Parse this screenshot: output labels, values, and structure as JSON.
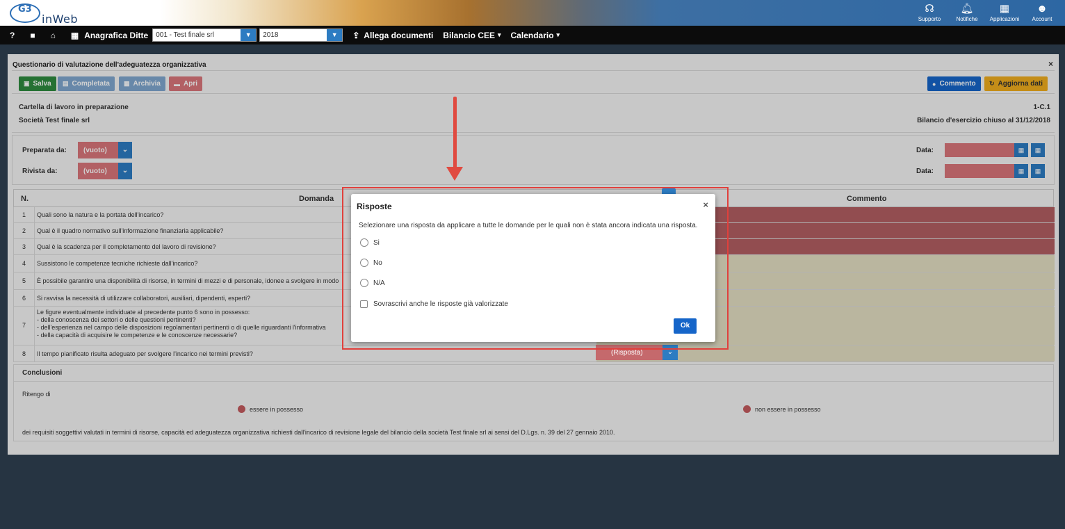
{
  "app": {
    "logo_mark": "G3",
    "logo_text": "inWeb"
  },
  "top_icons": [
    {
      "icon": "headset-icon",
      "glyph": "☊",
      "label": "Supporto"
    },
    {
      "icon": "bell-icon",
      "glyph": "♫",
      "label": "Notifiche"
    },
    {
      "icon": "grid-icon",
      "glyph": "▦",
      "label": "Applicazioni"
    },
    {
      "icon": "account-icon",
      "glyph": "☻",
      "label": "Account"
    }
  ],
  "nav": {
    "help": "?",
    "video": "■",
    "home": "⌂",
    "anagrafica_label": "Anagrafica Ditte",
    "company_select": "001 - Test finale srl",
    "year_select": "2018",
    "allega_label": "Allega documenti",
    "bilancio_label": "Bilancio CEE",
    "calendario_label": "Calendario"
  },
  "panel": {
    "title": "Questionario di valutazione dell'adeguatezza organizzativa",
    "close": "×",
    "buttons": {
      "salva": "Salva",
      "completata": "Completata",
      "archivia": "Archivia",
      "apri": "Apri",
      "commento": "Commento",
      "aggiorna": "Aggiorna dati"
    },
    "info": {
      "status": "Cartella di lavoro in preparazione",
      "company": "Società Test finale srl",
      "code": "1-C.1",
      "period": "Bilancio d'esercizio chiuso al 31/12/2018"
    },
    "prep": {
      "preparata_label": "Preparata da:",
      "rivista_label": "Rivista da:",
      "empty_value": "(vuoto)",
      "data_label": "Data:"
    },
    "table": {
      "col_n": "N.",
      "col_domanda": "Domanda",
      "col_commento": "Commento",
      "rows": [
        {
          "n": "1",
          "text": "Quali sono la natura e la portata dell'incarico?",
          "state": "red"
        },
        {
          "n": "2",
          "text": "Qual è il quadro normativo sull'informazione finanziaria applicabile?",
          "state": "red"
        },
        {
          "n": "3",
          "text": "Qual è la scadenza per il completamento del lavoro di revisione?",
          "state": "red"
        },
        {
          "n": "4",
          "text": "Sussistono le competenze tecniche richieste dall'incarico?",
          "state": "yellow"
        },
        {
          "n": "5",
          "text": "È possibile garantire una disponibilità di risorse, in termini di mezzi e di personale, idonee a svolgere in modo",
          "state": "yellow"
        },
        {
          "n": "6",
          "text": "Si ravvisa la necessità di utilizzare collaboratori, ausiliari, dipendenti, esperti?",
          "state": "yellow"
        },
        {
          "n": "7",
          "text_lines": [
            "Le figure eventualmente individuate al precedente punto 6 sono in possesso:",
            " - della conoscenza dei settori o delle questioni pertinenti?",
            " - dell'esperienza nel campo delle disposizioni regolamentari pertinenti o di quelle riguardanti l'informativa",
            " - della capacità di acquisire le competenze e le conoscenze necessarie?"
          ],
          "state": "yellow"
        },
        {
          "n": "8",
          "text": "Il tempo pianificato risulta adeguato per svolgere l'incarico nei termini previsti?",
          "state": "yellow",
          "answer": "(Risposta)"
        }
      ]
    },
    "conclusioni": {
      "title": "Conclusioni",
      "ritengo": "Ritengo di",
      "option_yes": "essere in possesso",
      "option_no": "non essere in possesso",
      "footer": "dei requisiti soggettivi valutati in termini di risorse, capacità ed adeguatezza organizzativa richiesti dall'incarico di revisione legale del bilancio della società Test finale srl ai sensi del D.Lgs. n. 39 del 27 gennaio 2010."
    }
  },
  "modal": {
    "title": "Risposte",
    "close": "×",
    "description": "Selezionare una risposta da applicare a tutte le domande per le quali non è stata ancora indicata una risposta.",
    "options": [
      "Si",
      "No",
      "N/A"
    ],
    "overwrite_label": "Sovrascrivi anche le risposte già valorizzate",
    "ok_label": "Ok"
  },
  "colors": {
    "primary": "#2d7cc2",
    "success": "#2e8a3f",
    "danger": "#d9767a",
    "warning": "#f0ad1e",
    "row_red": "#b25e62",
    "row_yellow": "#e3dfc2",
    "highlight": "#e0403c"
  }
}
